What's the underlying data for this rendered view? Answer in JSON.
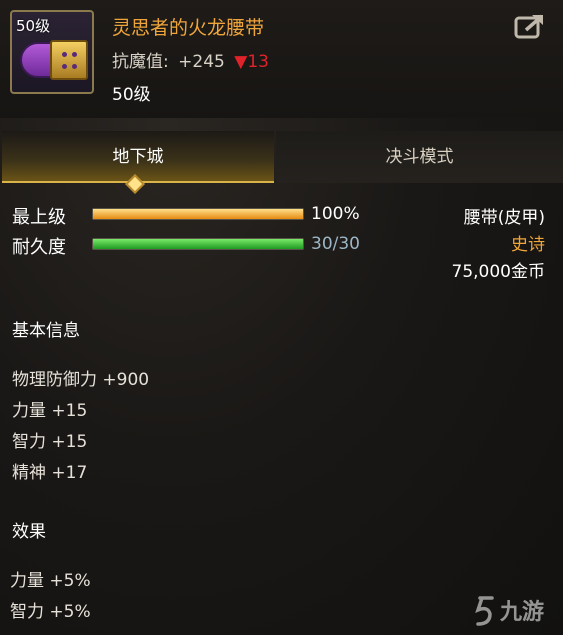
{
  "header": {
    "icon_level": "50级",
    "item_name": "灵思者的火龙腰带",
    "stat_label": "抗魔值:",
    "stat_value": "+245",
    "stat_diff": "▼13",
    "level": "50级",
    "share_icon": "share-icon"
  },
  "tabs": [
    {
      "label": "地下城",
      "active": true
    },
    {
      "label": "决斗模式",
      "active": false
    }
  ],
  "bars": [
    {
      "label": "最上级",
      "value": "100%",
      "fraction": 1.0,
      "color": "#f0a030"
    },
    {
      "label": "耐久度",
      "value": "30/30",
      "fraction": 1.0,
      "color": "#3cc43a",
      "value_color": "#9cb6c6"
    }
  ],
  "right_info": {
    "type": "腰带(皮甲)",
    "rarity": "史诗",
    "rarity_color": "#f0a53a",
    "price": "75,000金币"
  },
  "basic_info": {
    "title": "基本信息",
    "attrs": [
      "物理防御力 +900",
      "力量 +15",
      "智力 +15",
      "精神 +17"
    ]
  },
  "effects": {
    "title": "效果",
    "items": [
      "力量 +5%",
      "智力 +5%"
    ]
  },
  "watermark": "九游"
}
